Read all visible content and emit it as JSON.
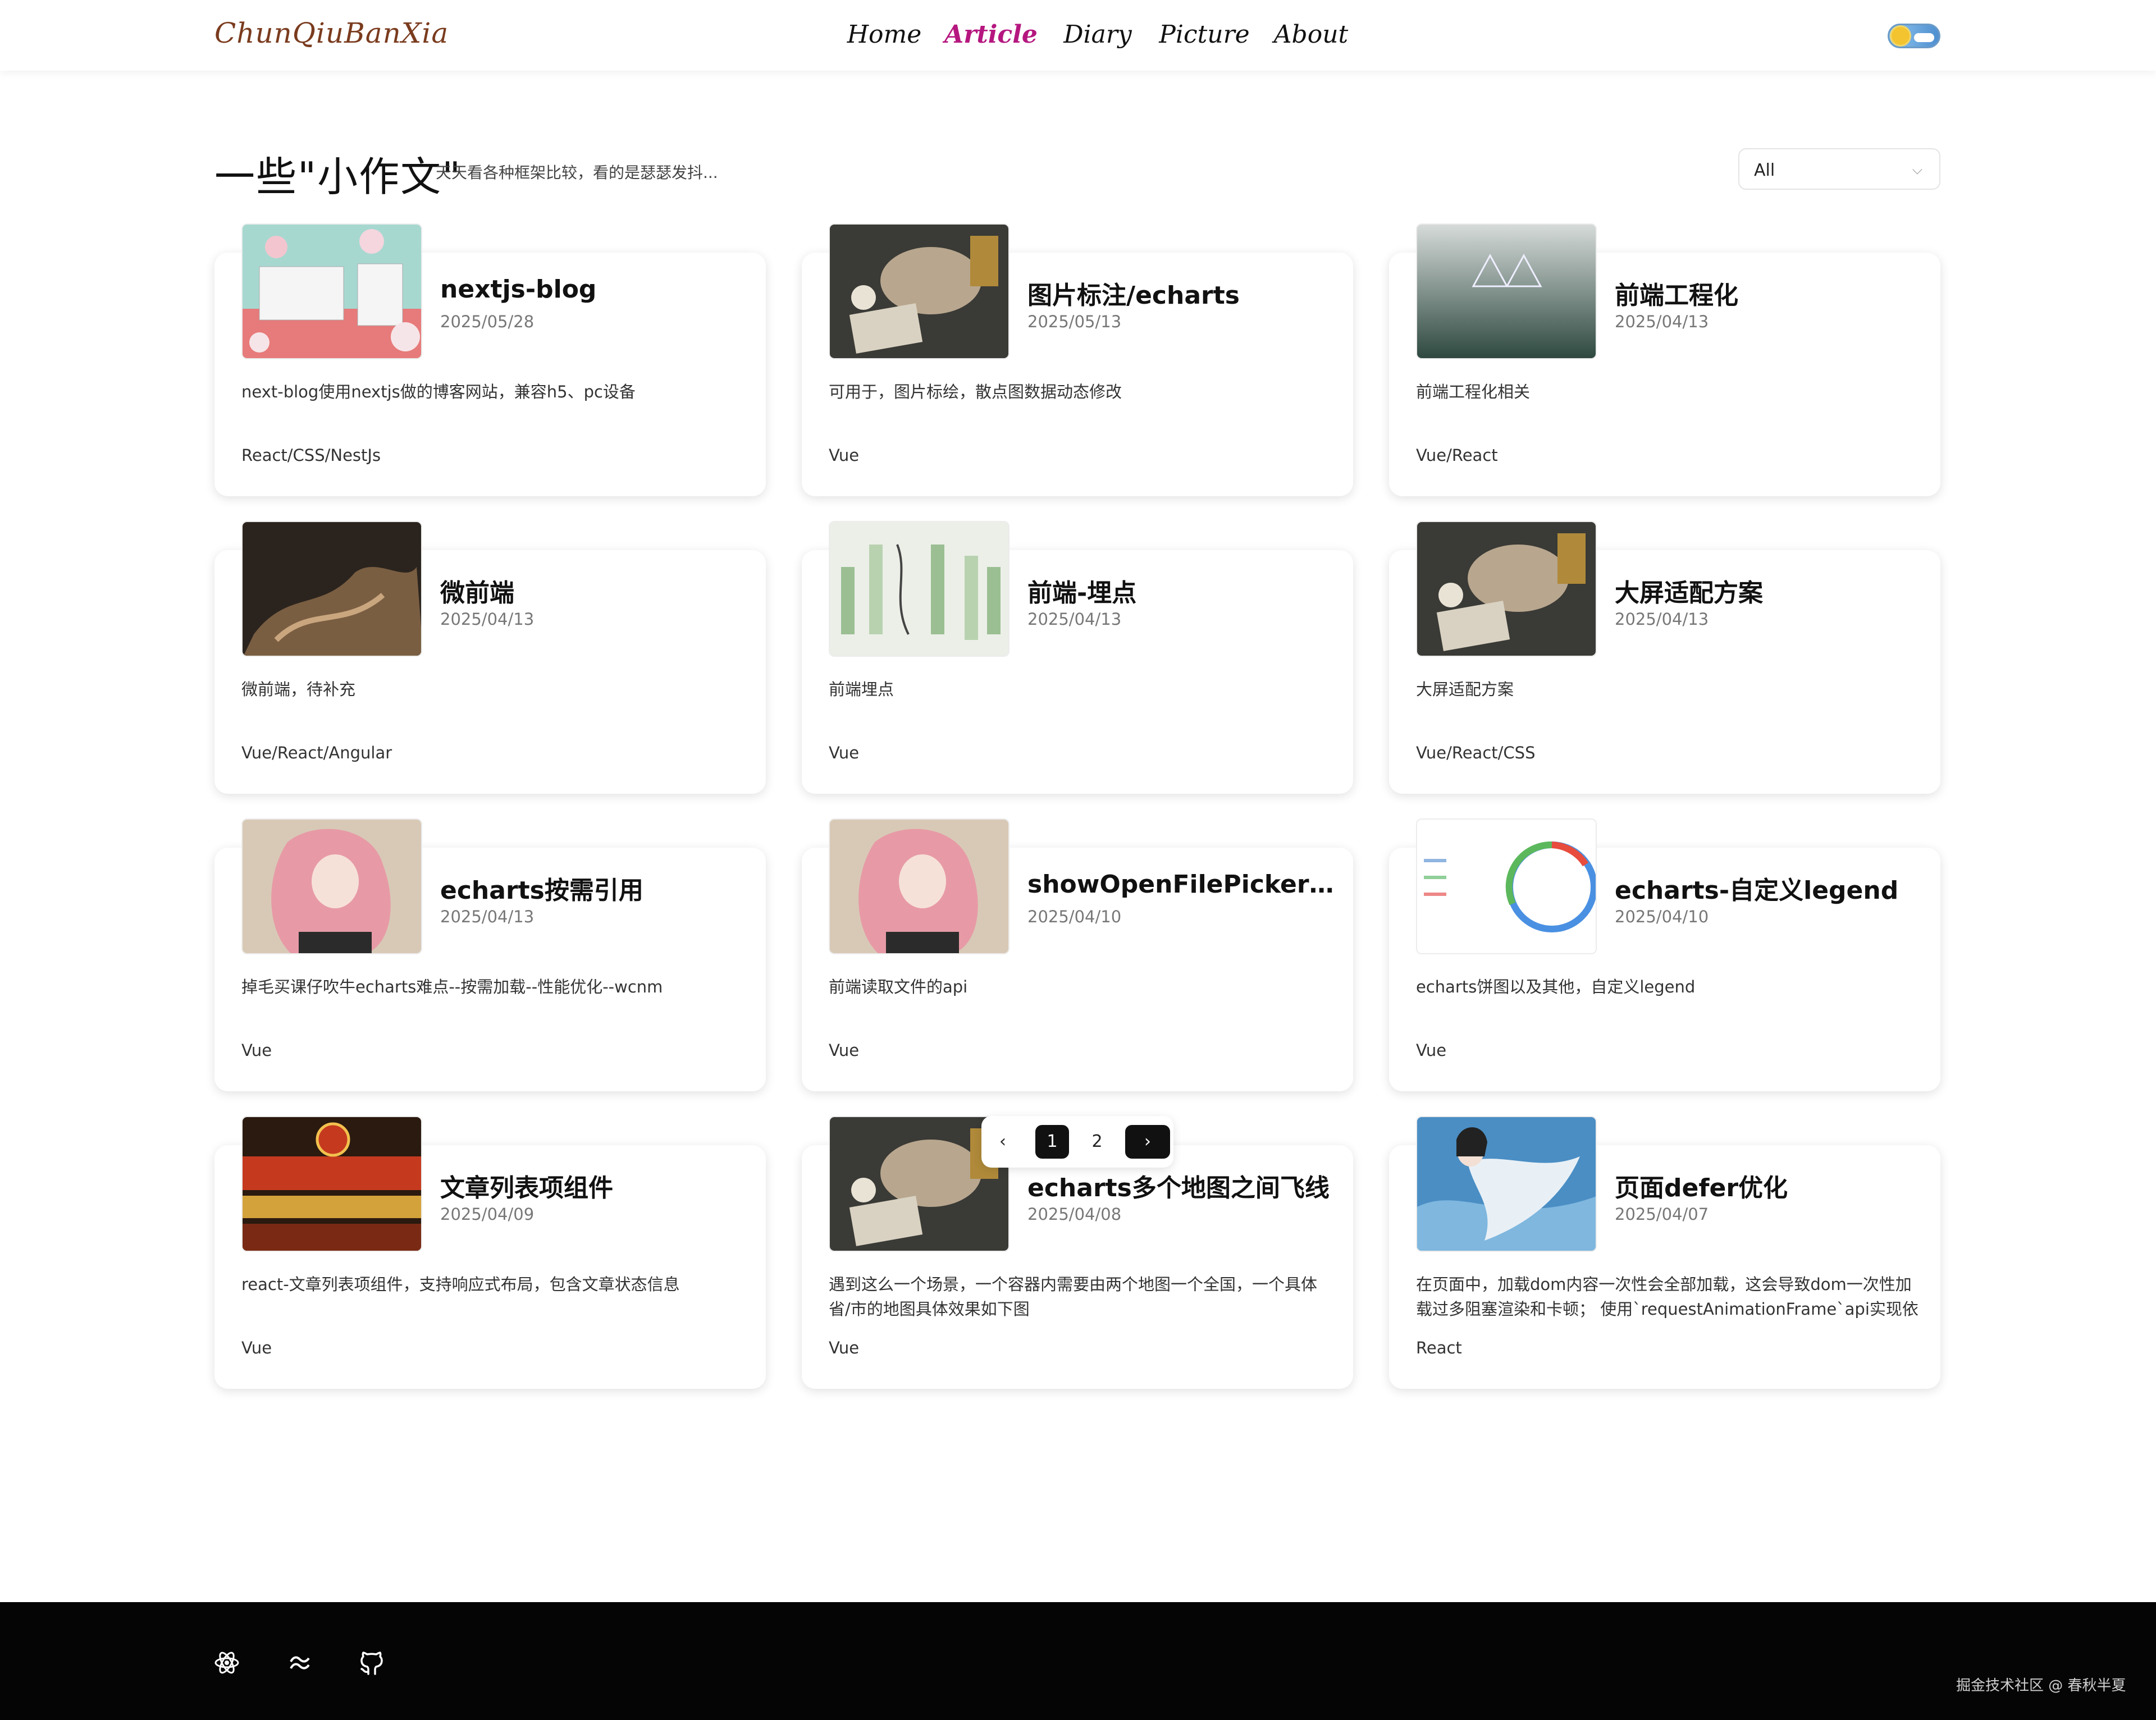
{
  "header": {
    "logo": "ChunQiuBanXia",
    "nav": [
      {
        "label": "Home",
        "active": false
      },
      {
        "label": "Article",
        "active": true
      },
      {
        "label": "Diary",
        "active": false
      },
      {
        "label": "Picture",
        "active": false
      },
      {
        "label": "About",
        "active": false
      }
    ],
    "theme_toggle_icon": "sun-cloud-toggle-icon"
  },
  "page": {
    "title": "一些\"小作文\"",
    "subtitle": "天天看各种框架比较，看的是瑟瑟发抖...",
    "filter": {
      "value": "All",
      "icon": "chevron-down-icon"
    }
  },
  "cards": [
    {
      "title": "nextjs-blog",
      "date": "2025/05/28",
      "desc": "next-blog使用nextjs做的博客网站，兼容h5、pc设备",
      "tags": "React/CSS/NestJs",
      "thumb_colors": [
        "#a6d8d0",
        "#e77a7a"
      ]
    },
    {
      "title": "图片标注/echarts",
      "date": "2025/05/13",
      "desc": "可用于，图片标绘，散点图数据动态修改",
      "tags": "Vue",
      "thumb_colors": [
        "#3a3a36",
        "#a8927a"
      ]
    },
    {
      "title": "前端工程化",
      "date": "2025/04/13",
      "desc": "前端工程化相关",
      "tags": "Vue/React",
      "thumb_colors": [
        "#cfd5d2",
        "#2d4a40"
      ]
    },
    {
      "title": "微前端",
      "date": "2025/04/13",
      "desc": "微前端，待补充",
      "tags": "Vue/React/Angular",
      "thumb_colors": [
        "#2b241e",
        "#7a5e42"
      ]
    },
    {
      "title": "前端-埋点",
      "date": "2025/04/13",
      "desc": "前端埋点",
      "tags": "Vue",
      "thumb_colors": [
        "#ecefe8",
        "#9bbf93"
      ]
    },
    {
      "title": "大屏适配方案",
      "date": "2025/04/13",
      "desc": "大屏适配方案",
      "tags": "Vue/React/CSS",
      "thumb_colors": [
        "#3a3a36",
        "#a8927a"
      ]
    },
    {
      "title": "echarts按需引用",
      "date": "2025/04/13",
      "desc": "掉毛买课仔吹牛echarts难点--按需加载--性能优化--wcnm",
      "tags": "Vue",
      "thumb_colors": [
        "#d8c9b6",
        "#e79aa6"
      ]
    },
    {
      "title": "showOpenFilePicker Api...",
      "date": "2025/04/10",
      "desc": "前端读取文件的api",
      "tags": "Vue",
      "thumb_colors": [
        "#d8c9b6",
        "#e79aa6"
      ]
    },
    {
      "title": "echarts-自定义legend",
      "date": "2025/04/10",
      "desc": "echarts饼图以及其他，自定义legend",
      "tags": "Vue",
      "thumb_colors": [
        "#ffffff",
        "#4a90e2"
      ]
    },
    {
      "title": "文章列表项组件",
      "date": "2025/04/09",
      "desc": "react-文章列表项组件，支持响应式布局，包含文章状态信息",
      "tags": "Vue",
      "thumb_colors": [
        "#c53a1e",
        "#2b1a0f"
      ]
    },
    {
      "title": "echarts多个地图之间飞线",
      "date": "2025/04/08",
      "desc": "遇到这么一个场景，一个容器内需要由两个地图一个全国，一个具体省/市的地图具体效果如下图",
      "tags": "Vue",
      "thumb_colors": [
        "#3a3a36",
        "#a8927a"
      ]
    },
    {
      "title": "页面defer优化",
      "date": "2025/04/07",
      "desc": "在页面中，加载dom内容一次性会全部加载，这会导致dom一次性加载过多阻塞渲染和卡顿； 使用`requestAnimationFrame`api实现依次...",
      "tags": "React",
      "thumb_colors": [
        "#4a8ec4",
        "#e8f0f6"
      ]
    }
  ],
  "pagination": {
    "prev": "‹",
    "pages": [
      "1",
      "2"
    ],
    "current": "1",
    "next": "›"
  },
  "footer": {
    "icons": [
      "react-icon",
      "tailwind-icon",
      "github-icon"
    ],
    "text": "掘金技术社区 @ 春秋半夏"
  }
}
